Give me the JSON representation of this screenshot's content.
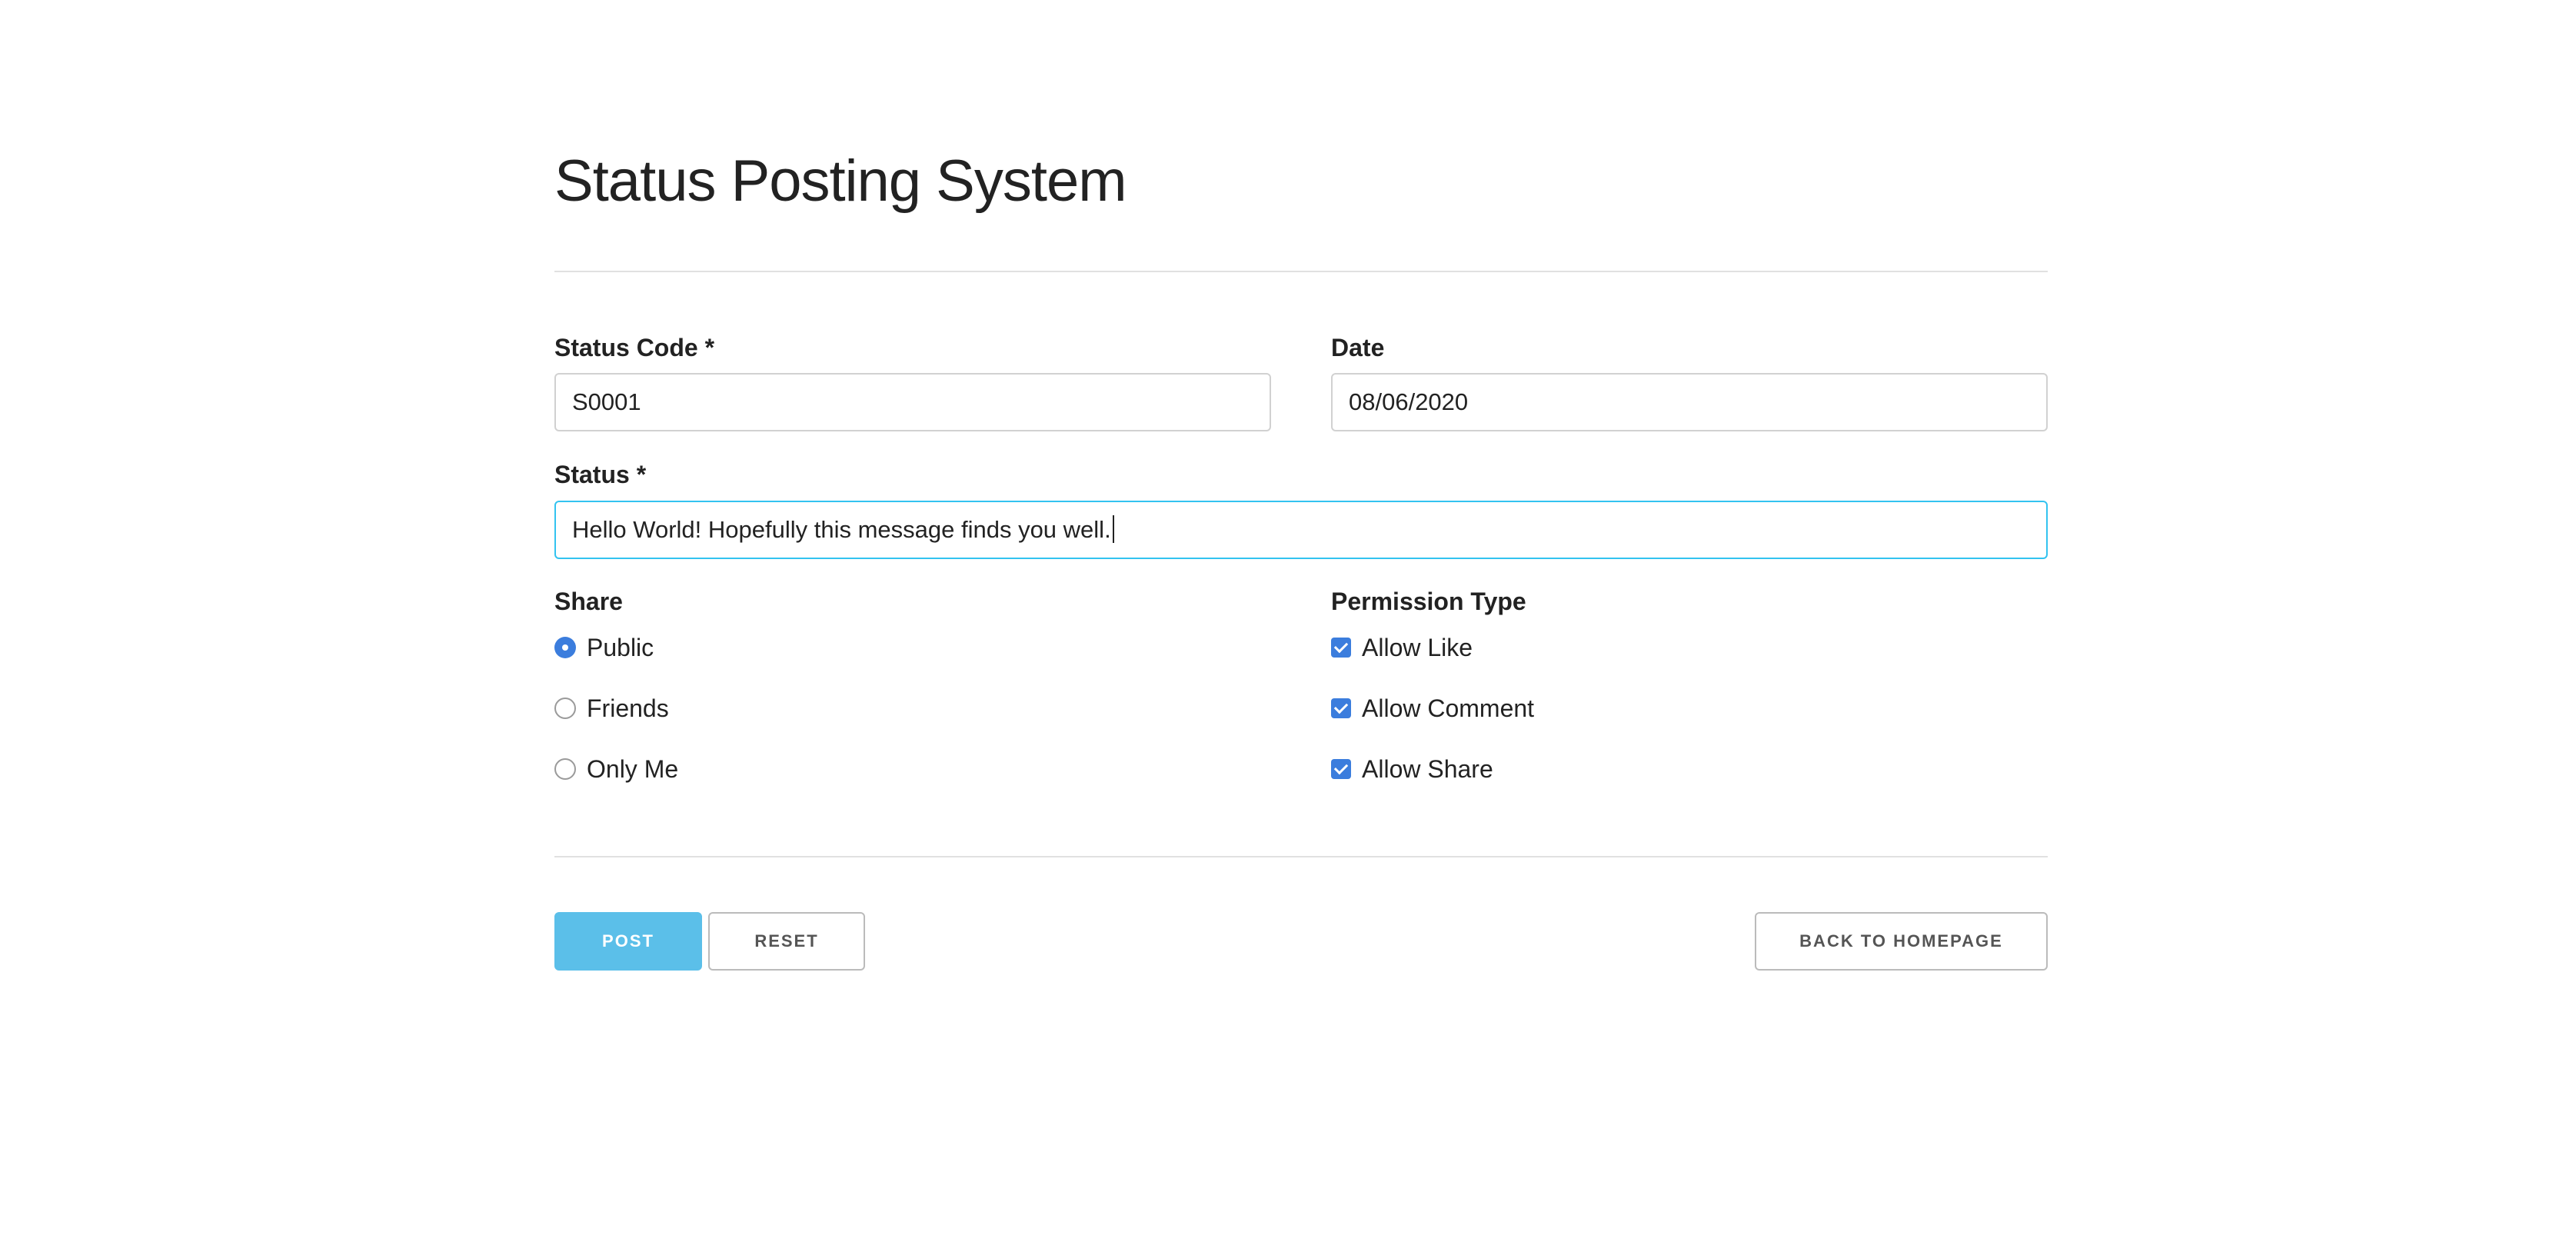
{
  "header": {
    "title": "Status Posting System"
  },
  "form": {
    "status_code": {
      "label": "Status Code *",
      "value": "S0001"
    },
    "date": {
      "label": "Date",
      "value": "08/06/2020"
    },
    "status": {
      "label": "Status *",
      "value": "Hello World! Hopefully this message finds you well."
    },
    "share": {
      "label": "Share",
      "options": [
        {
          "label": "Public",
          "checked": true
        },
        {
          "label": "Friends",
          "checked": false
        },
        {
          "label": "Only Me",
          "checked": false
        }
      ]
    },
    "permission": {
      "label": "Permission Type",
      "options": [
        {
          "label": "Allow Like",
          "checked": true
        },
        {
          "label": "Allow Comment",
          "checked": true
        },
        {
          "label": "Allow Share",
          "checked": true
        }
      ]
    }
  },
  "actions": {
    "post_label": "POST",
    "reset_label": "RESET",
    "back_label": "BACK TO HOMEPAGE"
  },
  "colors": {
    "accent": "#5bbfe9",
    "focus_border": "#33c3f0",
    "control_blue": "#3b7ddd"
  }
}
